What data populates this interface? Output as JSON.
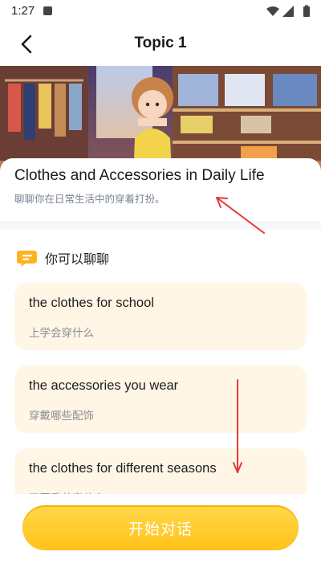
{
  "status_bar": {
    "time": "1:27",
    "icons": [
      "notification-a-icon",
      "wifi-icon",
      "battery-icon",
      "signal-icon"
    ]
  },
  "header": {
    "title": "Topic 1",
    "back_icon": "chevron-left-icon"
  },
  "topic": {
    "title": "Clothes and Accessories in Daily Life",
    "subtitle": "聊聊你在日常生活中的穿着打扮。"
  },
  "section": {
    "label": "你可以聊聊",
    "icon": "chat-bubble-icon"
  },
  "suggestions": [
    {
      "en": "the clothes for school",
      "zh": "上学会穿什么"
    },
    {
      "en": "the accessories you wear",
      "zh": "穿戴哪些配饰"
    },
    {
      "en": "the clothes for different seasons",
      "zh": "不同季节穿什么"
    }
  ],
  "start_button": {
    "label": "开始对话"
  },
  "colors": {
    "accent": "#ffc21a",
    "card_bg": "#fff6e6",
    "annotation_arrow": "#e53935"
  }
}
